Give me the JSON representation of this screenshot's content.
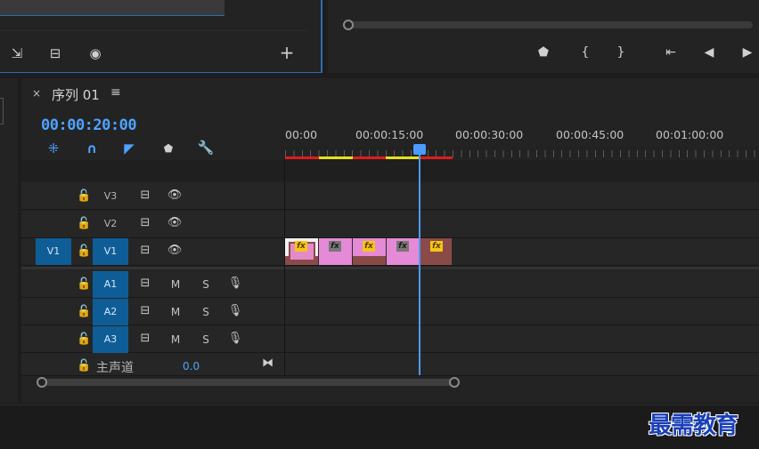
{
  "window": {
    "accent": "#4a9bff",
    "track_target_color": "#0f5d96"
  },
  "source_monitor": {
    "tools": [
      {
        "icon": "insert-icon",
        "glyph": "⇲"
      },
      {
        "icon": "overwrite-icon",
        "glyph": "⊟"
      },
      {
        "icon": "camera-icon",
        "glyph": "◉"
      }
    ],
    "add_glyph": "+"
  },
  "program_monitor": {
    "buttons": [
      {
        "icon": "add-marker-icon",
        "glyph": "⬟"
      },
      {
        "icon": "mark-in-icon",
        "glyph": "{"
      },
      {
        "icon": "mark-out-icon",
        "glyph": "}"
      },
      {
        "icon": "go-to-in-icon",
        "glyph": "⇤"
      },
      {
        "icon": "step-back-icon",
        "glyph": "◀"
      },
      {
        "icon": "play-icon",
        "glyph": "▶"
      }
    ]
  },
  "timeline": {
    "close_glyph": "×",
    "title": "序列 01",
    "menu_glyph": "≡",
    "timecode": "00:00:20:00",
    "tools": [
      {
        "icon": "snap-nest-icon",
        "glyph": "⁜",
        "color": "#4da3ff"
      },
      {
        "icon": "magnet-icon",
        "glyph": "∩",
        "color": "#4da3ff"
      },
      {
        "icon": "linked-selection-icon",
        "glyph": "◤",
        "color": "#4da3ff"
      },
      {
        "icon": "add-marker-icon",
        "glyph": "⬟",
        "color": "#cfcfcf"
      },
      {
        "icon": "wrench-icon",
        "glyph": "🔧",
        "color": "#cfcfcf"
      }
    ],
    "ruler": [
      "00:00",
      "00:00:15:00",
      "00:00:30:00",
      "00:00:45:00",
      "00:01:00:00"
    ],
    "video_tracks": [
      {
        "name": "V3",
        "source": "",
        "targeted": false
      },
      {
        "name": "V2",
        "source": "",
        "targeted": false
      },
      {
        "name": "V1",
        "source": "V1",
        "targeted": true
      }
    ],
    "audio_tracks": [
      {
        "name": "A1",
        "mute": "M",
        "solo": "S"
      },
      {
        "name": "A2",
        "mute": "M",
        "solo": "S"
      },
      {
        "name": "A3",
        "mute": "M",
        "solo": "S"
      }
    ],
    "master": {
      "label": "主声道",
      "value": "0.0"
    },
    "clips": [
      {
        "fx": "fx",
        "top": "#f0f0f0",
        "bottom": "#8a4a48",
        "fx_bg": "#f5c518",
        "fx_fg": "#5a3c00",
        "inner": "#e58ac9"
      },
      {
        "fx": "fx",
        "top": "#e58ad6",
        "bottom": "#e58ad6",
        "fx_bg": "#777777",
        "fx_fg": "#1a1a1a",
        "inner": ""
      },
      {
        "fx": "fx",
        "top": "#e58ad6",
        "bottom": "#8a4a48",
        "fx_bg": "#f5c518",
        "fx_fg": "#5a3c00",
        "inner": ""
      },
      {
        "fx": "fx",
        "top": "#e58ad6",
        "bottom": "#e58ad6",
        "fx_bg": "#777777",
        "fx_fg": "#1a1a1a",
        "inner": ""
      },
      {
        "fx": "fx",
        "top": "#8a4a48",
        "bottom": "#8a4a48",
        "fx_bg": "#f5c518",
        "fx_fg": "#5a3c00",
        "inner": ""
      }
    ]
  },
  "watermark": "最需教育"
}
